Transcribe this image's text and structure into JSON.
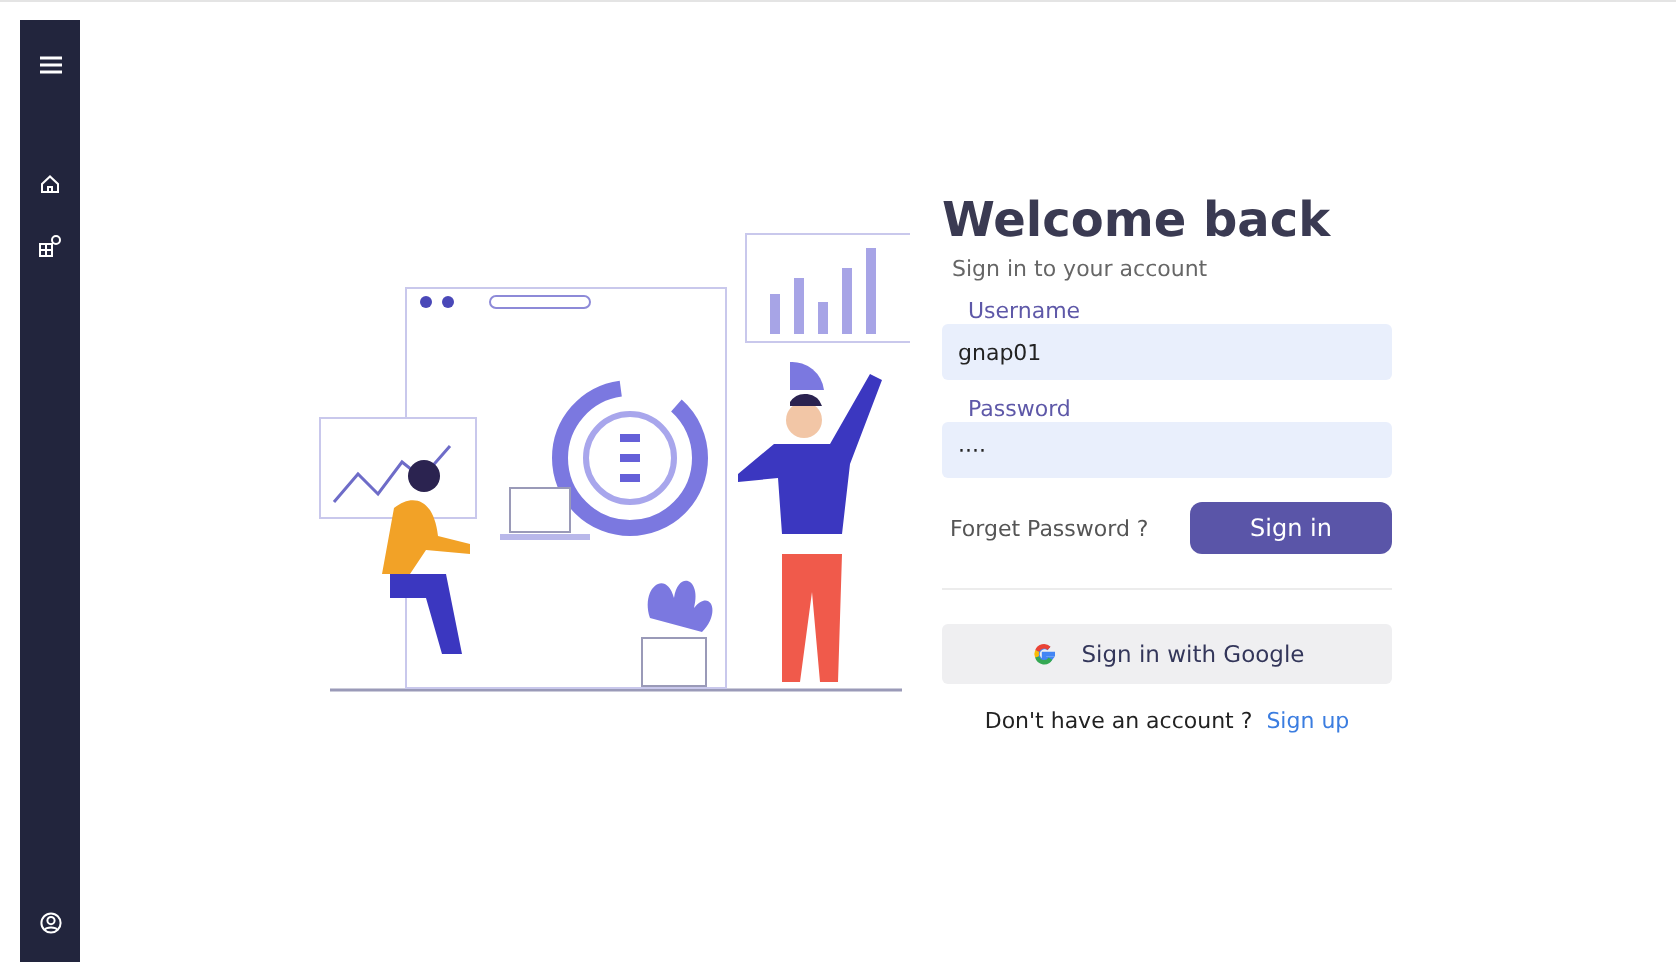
{
  "sidebar": {
    "items": [
      {
        "kind": "menu"
      },
      {
        "kind": "home"
      },
      {
        "kind": "apps"
      },
      {
        "kind": "account"
      }
    ]
  },
  "login": {
    "title": "Welcome back",
    "subtitle": "Sign in to your account",
    "fields": [
      {
        "label": "Username",
        "value": "gnap01"
      },
      {
        "label": "Password",
        "value": "····"
      }
    ],
    "forgot_link": "Forget Password ?",
    "sign_in_button": "Sign in",
    "google_button": "Sign in with Google",
    "signup_prompt": "Don't have an account ?",
    "signup_link": "Sign up"
  }
}
